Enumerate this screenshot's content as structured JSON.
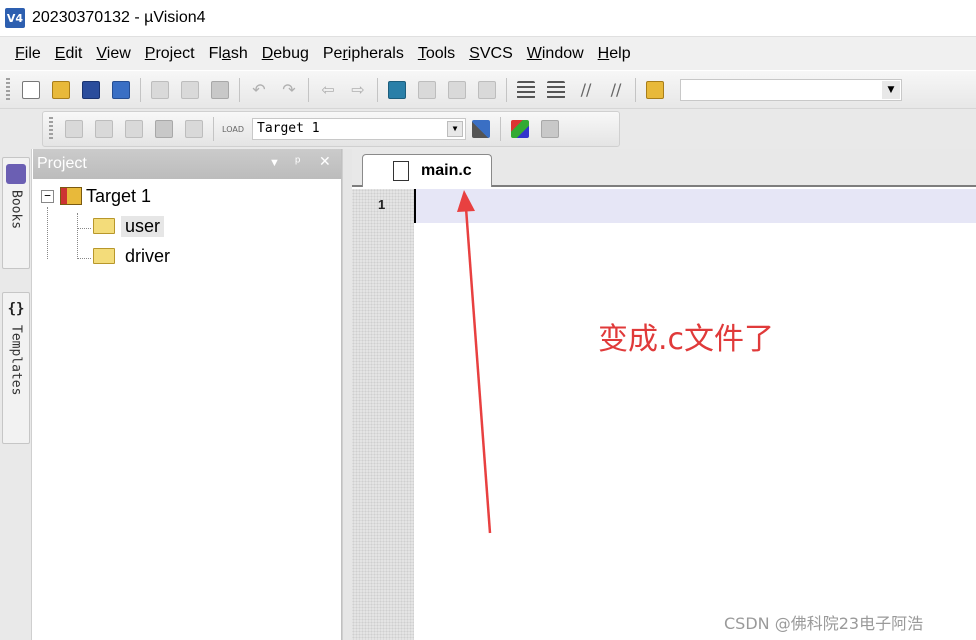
{
  "window": {
    "app_icon": "V4",
    "title": "20230370132  - µVision4"
  },
  "menu": [
    {
      "label": "File",
      "ul": "F",
      "rest": "ile"
    },
    {
      "label": "Edit",
      "ul": "E",
      "rest": "dit"
    },
    {
      "label": "View",
      "ul": "V",
      "rest": "iew"
    },
    {
      "label": "Project",
      "ul": "P",
      "rest": "roject"
    },
    {
      "label": "Flash",
      "pre": "Fl",
      "ul": "a",
      "rest": "sh"
    },
    {
      "label": "Debug",
      "ul": "D",
      "rest": "ebug"
    },
    {
      "label": "Peripherals",
      "pre": "Pe",
      "ul": "r",
      "rest": "ipherals"
    },
    {
      "label": "Tools",
      "ul": "T",
      "rest": "ools"
    },
    {
      "label": "SVCS",
      "ul": "S",
      "rest": "VCS"
    },
    {
      "label": "Window",
      "ul": "W",
      "rest": "indow"
    },
    {
      "label": "Help",
      "ul": "H",
      "rest": "elp"
    }
  ],
  "toolbar2": {
    "load_label": "LOAD",
    "target_select": "Target 1"
  },
  "sidebar_tabs": {
    "books": "Books",
    "templates_icon": "{}",
    "templates": "Templates"
  },
  "project_panel": {
    "title": "Project",
    "controls": [
      "▼",
      "ᵖ",
      "✕"
    ],
    "tree": {
      "expander": "−",
      "target": "Target 1",
      "groups": [
        "user",
        "driver"
      ]
    }
  },
  "editor": {
    "tab": "main.c",
    "line_numbers": [
      "1"
    ]
  },
  "annotation": {
    "text": "变成.c文件了",
    "color": "#e03a3a"
  },
  "watermark": "CSDN @佛科院23电子阿浩",
  "icons": {
    "toolbar1": [
      "new-file-icon",
      "open-folder-icon",
      "save-icon",
      "save-all-icon",
      "cut-icon",
      "copy-icon",
      "paste-icon",
      "undo-icon",
      "redo-icon",
      "back-icon",
      "forward-icon",
      "bookmark-icon",
      "prev-bookmark-icon",
      "next-bookmark-icon",
      "clear-bookmarks-icon",
      "indent-icon",
      "unindent-icon",
      "comment-icon",
      "uncomment-icon",
      "find-in-files-icon"
    ],
    "toolbar2": [
      "translate-icon",
      "build-icon",
      "rebuild-icon",
      "batch-build-icon",
      "stop-build-icon",
      "download-icon",
      "target-options-icon",
      "manage-components-icon",
      "select-packs-icon"
    ]
  }
}
